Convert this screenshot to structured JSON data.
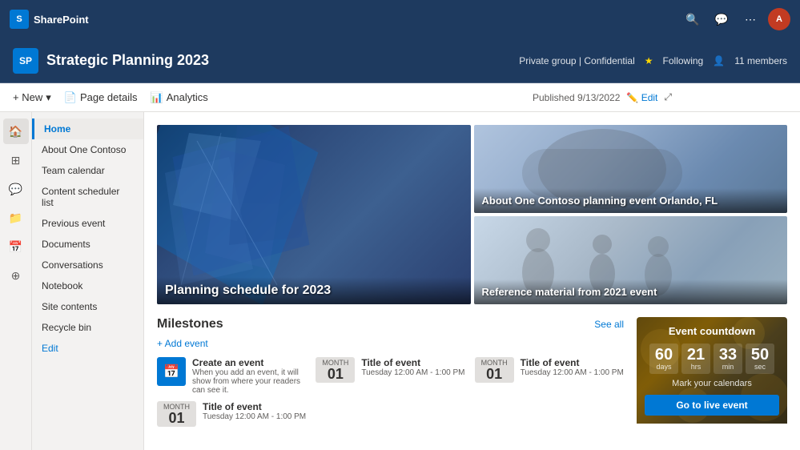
{
  "topbar": {
    "app_name": "SharePoint",
    "icons": [
      "search",
      "chat",
      "more"
    ]
  },
  "site_header": {
    "logo_text": "SP",
    "title": "Strategic Planning 2023",
    "privacy": "Private group | Confidential",
    "following": "Following",
    "members": "11 members"
  },
  "command_bar": {
    "new_label": "+ New",
    "page_details_label": "Page details",
    "analytics_label": "Analytics",
    "published_info": "Published 9/13/2022",
    "edit_label": "Edit"
  },
  "sidebar": {
    "items": [
      {
        "label": "Home",
        "active": true
      },
      {
        "label": "About One Contoso",
        "active": false
      },
      {
        "label": "Team calendar",
        "active": false
      },
      {
        "label": "Content scheduler list",
        "active": false
      },
      {
        "label": "Previous event",
        "active": false
      },
      {
        "label": "Documents",
        "active": false
      },
      {
        "label": "Conversations",
        "active": false
      },
      {
        "label": "Notebook",
        "active": false
      },
      {
        "label": "Site contents",
        "active": false
      },
      {
        "label": "Recycle bin",
        "active": false
      },
      {
        "label": "Edit",
        "is_edit": true
      }
    ]
  },
  "image_tiles": [
    {
      "id": "tile1",
      "title": "Planning schedule for 2023",
      "large": true
    },
    {
      "id": "tile2",
      "title": "About One Contoso planning event Orlando, FL",
      "large": false
    },
    {
      "id": "tile3",
      "title": "Reference material from 2021 event",
      "large": false
    }
  ],
  "milestones": {
    "title": "Milestones",
    "see_all": "See all",
    "add_event": "+ Add event",
    "create_event_title": "Create an event",
    "create_event_desc": "When you add an event, it will show from where your readers can see it.",
    "events": [
      {
        "month": "Month",
        "day": "01",
        "title": "Title of event",
        "time": "Tuesday 12:00 AM - 1:00 PM"
      },
      {
        "month": "Month",
        "day": "01",
        "title": "Title of event",
        "time": "Tuesday 12:00 AM - 1:00 PM"
      },
      {
        "month": "Month",
        "day": "01",
        "title": "Title of event",
        "time": "Tuesday 12:00 AM - 1:00 PM"
      }
    ]
  },
  "countdown": {
    "title": "Event countdown",
    "days": "60",
    "days_label": "days",
    "hours": "21",
    "hours_label": "hrs",
    "minutes": "33",
    "minutes_label": "min",
    "seconds": "50",
    "seconds_label": "sec",
    "mark_text": "Mark your calendars",
    "go_live": "Go to live event"
  }
}
